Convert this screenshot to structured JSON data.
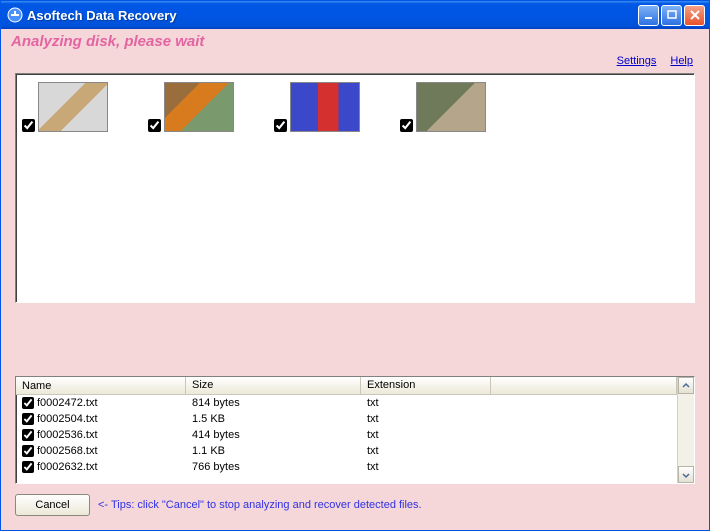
{
  "window": {
    "title": "Asoftech Data Recovery"
  },
  "status": "Analyzing disk, please wait",
  "links": {
    "settings": "Settings",
    "help": "Help"
  },
  "thumbnails": [
    {
      "checked": true
    },
    {
      "checked": true
    },
    {
      "checked": true
    },
    {
      "checked": true
    }
  ],
  "table": {
    "columns": {
      "name": "Name",
      "size": "Size",
      "extension": "Extension"
    },
    "rows": [
      {
        "checked": true,
        "name": "f0002472.txt",
        "size": "814 bytes",
        "ext": "txt"
      },
      {
        "checked": true,
        "name": "f0002504.txt",
        "size": "1.5 KB",
        "ext": "txt"
      },
      {
        "checked": true,
        "name": "f0002536.txt",
        "size": "414 bytes",
        "ext": "txt"
      },
      {
        "checked": true,
        "name": "f0002568.txt",
        "size": "1.1 KB",
        "ext": "txt"
      },
      {
        "checked": true,
        "name": "f0002632.txt",
        "size": "766 bytes",
        "ext": "txt"
      }
    ]
  },
  "buttons": {
    "cancel": "Cancel"
  },
  "tips": "<- Tips: click \"Cancel\" to stop analyzing and recover detected files."
}
